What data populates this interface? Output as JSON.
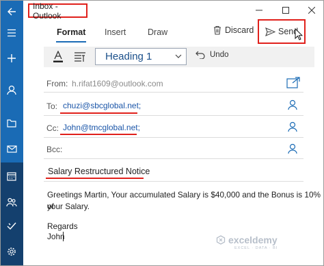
{
  "window": {
    "title": "Inbox - Outlook"
  },
  "ribbon": {
    "tabs": [
      {
        "label": "Format",
        "active": true
      },
      {
        "label": "Insert",
        "active": false
      },
      {
        "label": "Draw",
        "active": false
      }
    ],
    "discard_label": "Discard",
    "send_label": "Send"
  },
  "toolbar": {
    "style_value": "Heading 1",
    "undo_label": "Undo"
  },
  "compose": {
    "from_label": "From:",
    "from_value": "h.rifat1609@outlook.com",
    "to_label": "To:",
    "to_value": "chuzi@sbcglobal.net;",
    "cc_label": "Cc:",
    "cc_value": "John@tmcglobal.net;",
    "bcc_label": "Bcc:",
    "bcc_value": "",
    "subject": "Salary Restructured Notice",
    "body_line1": "Greetings Martin, Your accumulated Salary is $40,000 and the Bonus is 10% of",
    "body_line2": "your Salary.",
    "body_line3": "Regards",
    "body_line4": "John"
  },
  "watermark": {
    "name": "exceldemy",
    "tagline": "EXCEL · DATA · BI"
  },
  "colors": {
    "rail": "#1a6bb5",
    "rail_dark": "#14406e",
    "highlight": "#e0201b",
    "accent": "#1a6bb5"
  },
  "icons": [
    "back-arrow-icon",
    "hamburger-menu-icon",
    "new-mail-plus-icon",
    "account-icon",
    "folder-icon",
    "mail-icon",
    "calendar-icon",
    "people-icon",
    "todo-check-icon",
    "settings-gear-icon",
    "trash-icon",
    "send-icon",
    "font-color-icon",
    "paragraph-format-icon",
    "undo-icon",
    "popout-icon",
    "add-person-icon"
  ]
}
